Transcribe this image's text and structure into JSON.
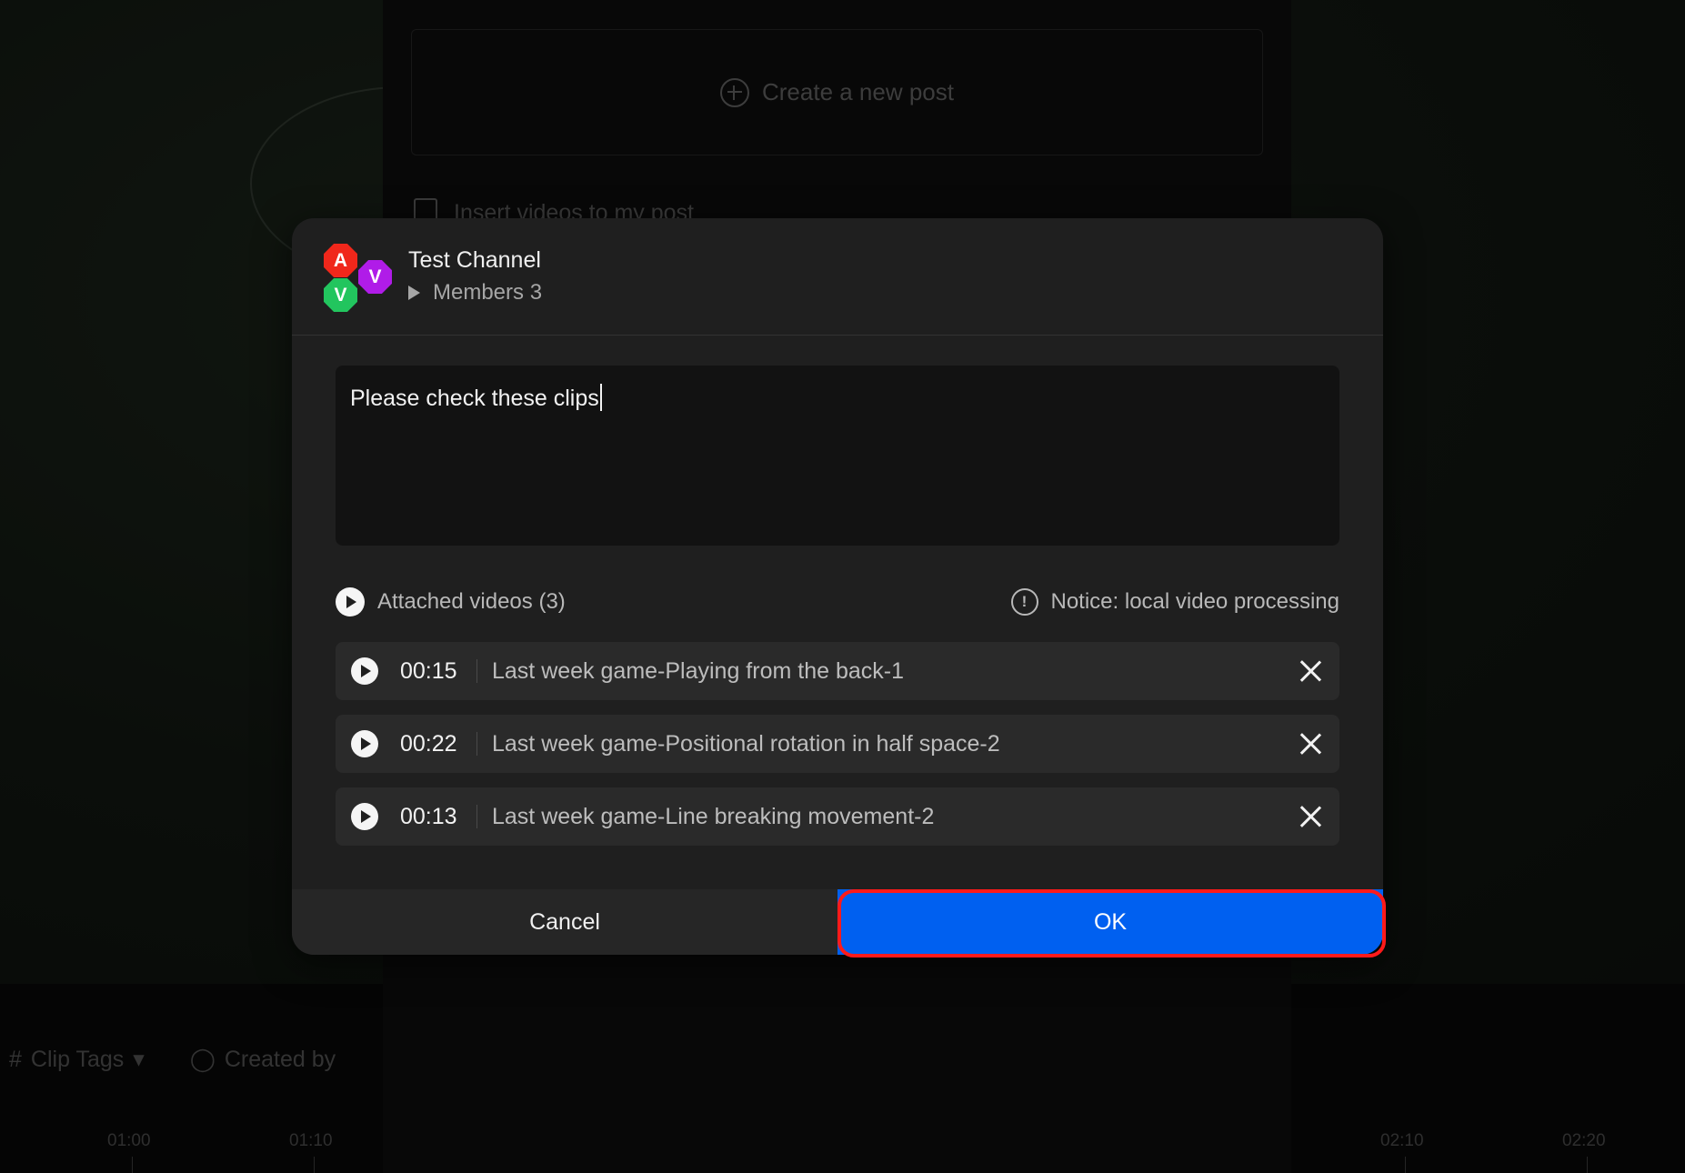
{
  "background": {
    "create_post_label": "Create a new post",
    "insert_videos_label": "Insert videos to my post",
    "filters": [
      {
        "icon": "hash-icon",
        "label": "Clip Tags"
      },
      {
        "icon": "user-icon",
        "label": "Created by"
      }
    ],
    "timeline_ticks": [
      "01:00",
      "01:10",
      "02:10",
      "02:20"
    ]
  },
  "modal": {
    "channel_name": "Test Channel",
    "members_label": "Members 3",
    "avatars": [
      {
        "letter": "A",
        "color": "#f0271b"
      },
      {
        "letter": "V",
        "color": "#22c55e"
      },
      {
        "letter": "V",
        "color": "#b01ce8"
      }
    ],
    "message_text": "Please check these clips",
    "attached_label": "Attached videos (3)",
    "notice_label": "Notice: local video processing",
    "videos": [
      {
        "duration": "00:15",
        "title": "Last week game-Playing from the back-1"
      },
      {
        "duration": "00:22",
        "title": "Last week game-Positional rotation in half space-2"
      },
      {
        "duration": "00:13",
        "title": "Last week game-Line breaking movement-2"
      }
    ],
    "cancel_label": "Cancel",
    "ok_label": "OK"
  },
  "colors": {
    "primary": "#0060f0",
    "highlight": "#ff1a1a",
    "modal_bg": "#1f1f1f"
  }
}
